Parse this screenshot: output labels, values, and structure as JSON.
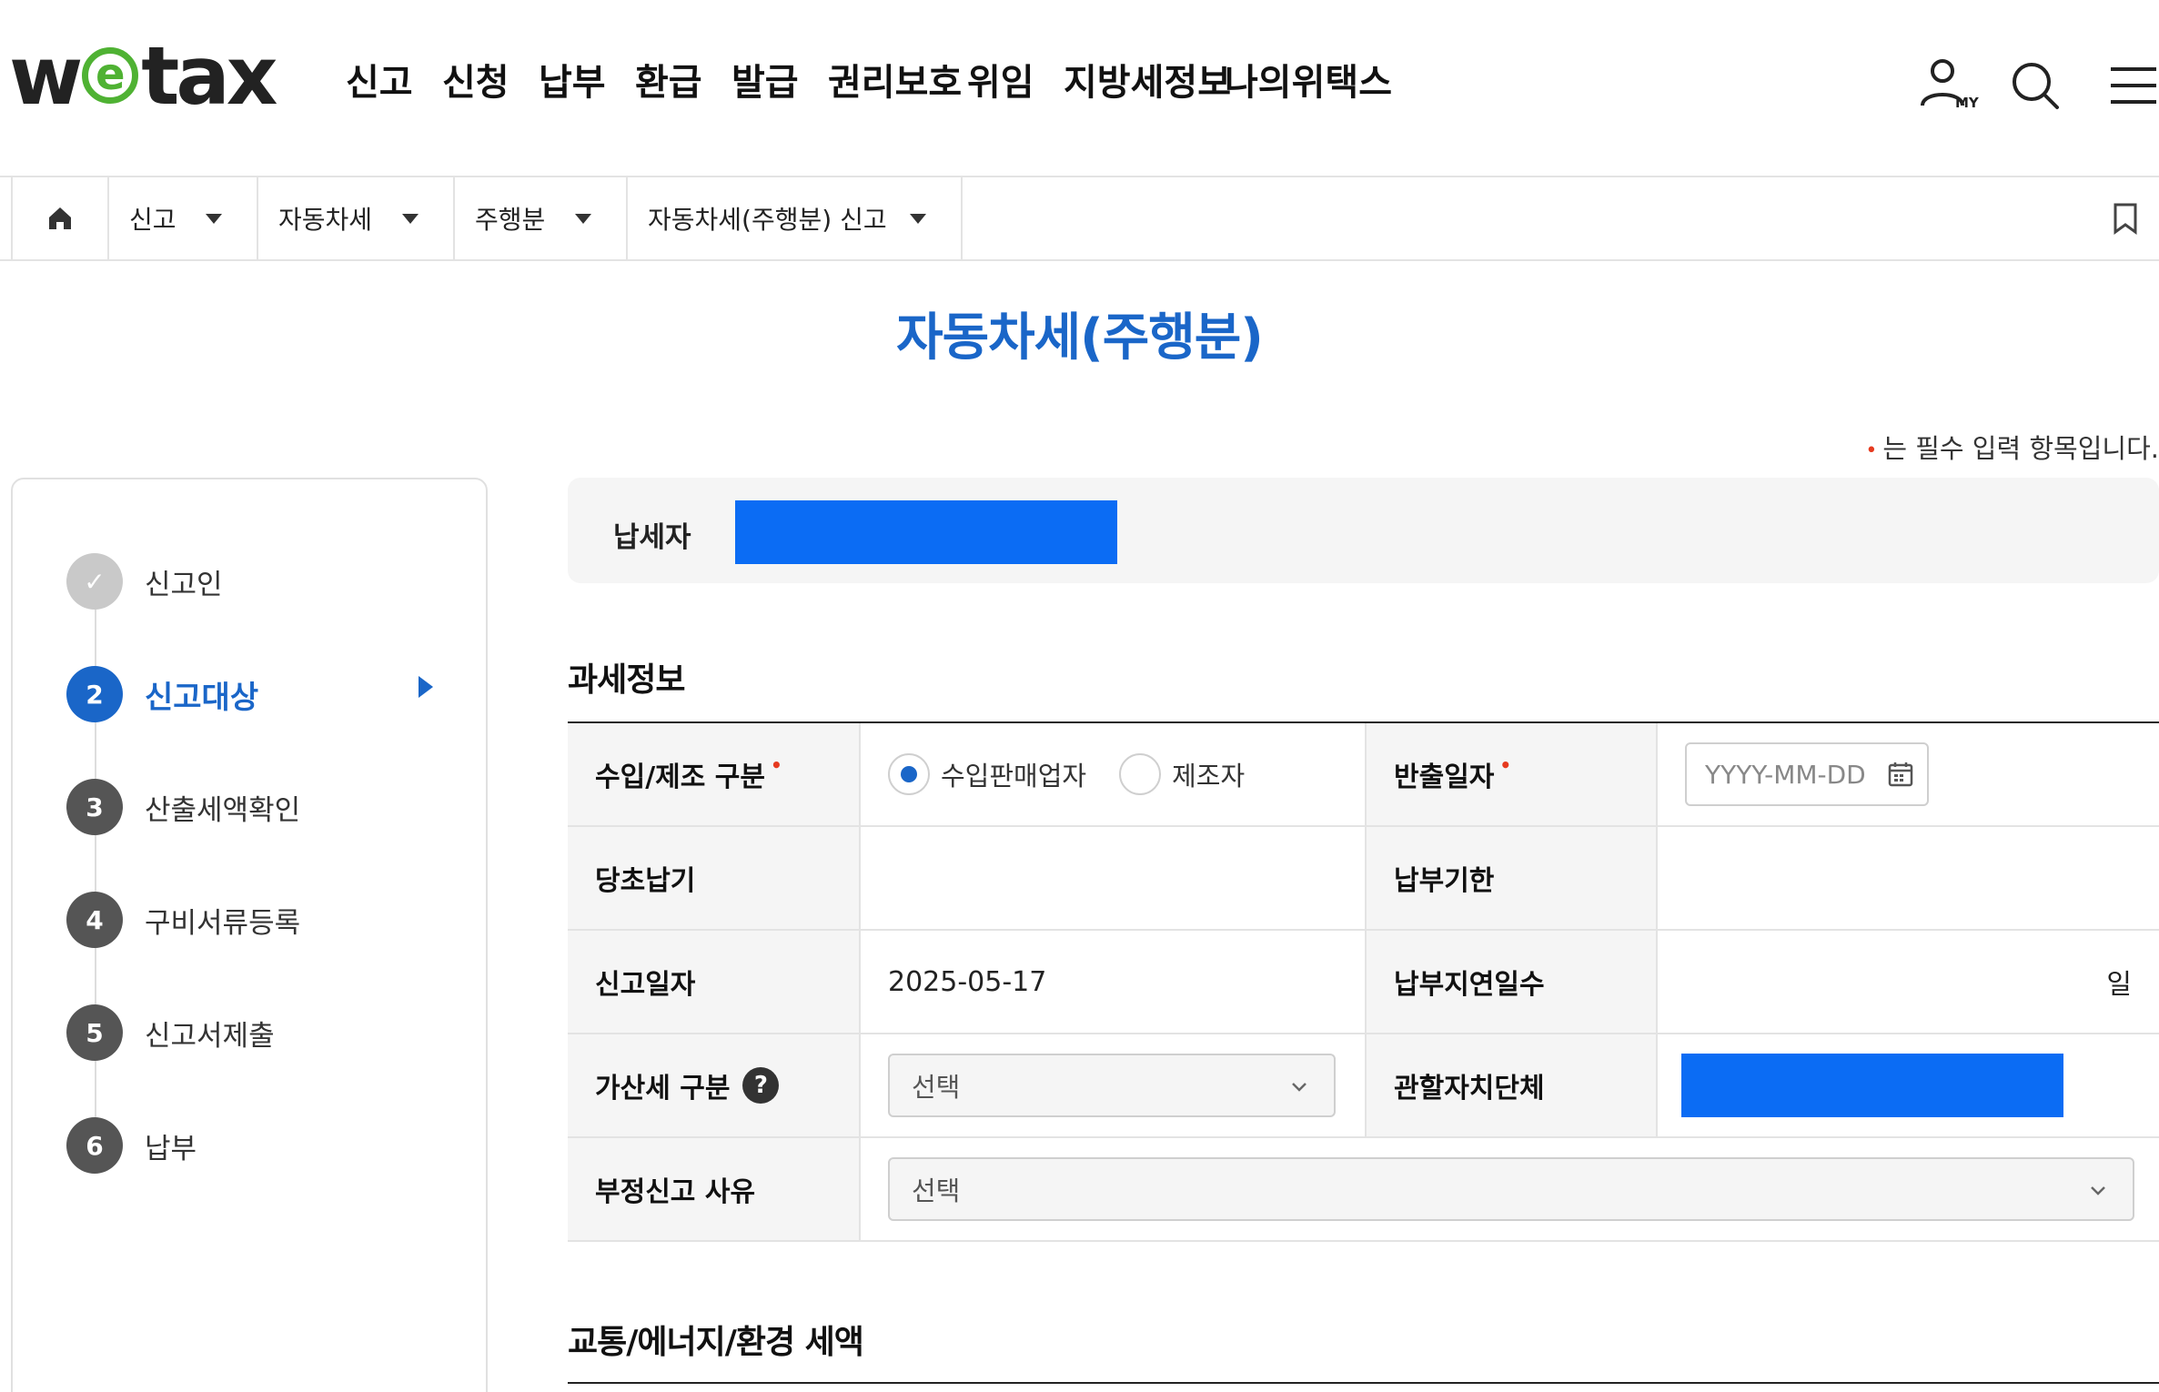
{
  "header": {
    "logo": {
      "pre": "w",
      "mid": "e",
      "post": "tax"
    },
    "nav": [
      "신고",
      "신청",
      "납부",
      "환급",
      "발급",
      "권리보호",
      "위임",
      "지방세정보",
      "나의위택스"
    ],
    "my_label": "MY",
    "icons": [
      "my-page-icon",
      "search-icon",
      "menu-icon"
    ]
  },
  "breadcrumb": {
    "items": [
      "신고",
      "자동차세",
      "주행분",
      "자동차세(주행분) 신고"
    ]
  },
  "page": {
    "title": "자동차세(주행분)",
    "required_note": "는 필수 입력 항목입니다.",
    "required_mark": "•"
  },
  "steps": [
    {
      "num": "✓",
      "label": "신고인",
      "state": "done"
    },
    {
      "num": "2",
      "label": "신고대상",
      "state": "active"
    },
    {
      "num": "3",
      "label": "산출세액확인",
      "state": "pending"
    },
    {
      "num": "4",
      "label": "구비서류등록",
      "state": "pending"
    },
    {
      "num": "5",
      "label": "신고서제출",
      "state": "pending"
    },
    {
      "num": "6",
      "label": "납부",
      "state": "pending"
    }
  ],
  "taxpayer": {
    "label": "납세자",
    "value_redacted": true
  },
  "sections": {
    "tax_info": "과세정보",
    "tax_amount": "교통/에너지/환경 세액"
  },
  "table": {
    "import_type_label": "수입/제조 구분",
    "import_options": [
      "수입판매업자",
      "제조자"
    ],
    "import_selected": "수입판매업자",
    "release_date_label": "반출일자",
    "release_date_placeholder": "YYYY-MM-DD",
    "orig_due_label": "당초납기",
    "orig_due_value": "",
    "pay_deadline_label": "납부기한",
    "pay_deadline_value": "",
    "report_date_label": "신고일자",
    "report_date_value": "2025-05-17",
    "delay_days_label": "납부지연일수",
    "delay_days_unit": "일",
    "penalty_label": "가산세 구분",
    "penalty_help": "?",
    "penalty_select": "선택",
    "jurisdiction_label": "관할자치단체",
    "jurisdiction_redacted": true,
    "fraud_reason_label": "부정신고 사유",
    "fraud_reason_select": "선택"
  },
  "colors": {
    "accent": "#1a66c8",
    "logo_green": "#4fb233",
    "required": "#e63a1f",
    "redaction": "#0b6cf4"
  }
}
